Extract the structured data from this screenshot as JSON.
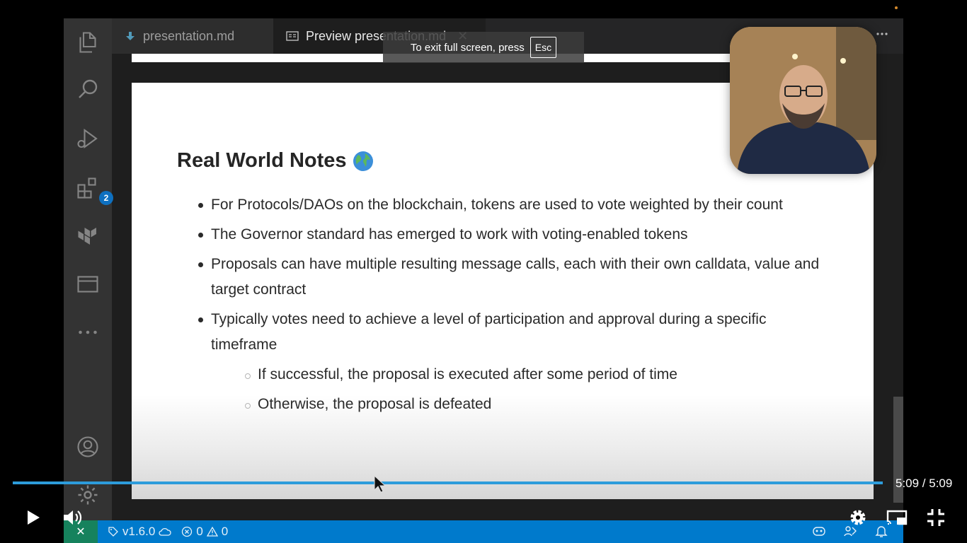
{
  "editor": {
    "tabs": [
      {
        "label": "presentation.md",
        "active": false
      },
      {
        "label": "Preview presentation.md",
        "active": true
      }
    ],
    "activity_bar": {
      "items": [
        "explorer",
        "search",
        "run-debug",
        "extensions",
        "terraform",
        "panel",
        "more"
      ],
      "extensions_badge": "2"
    },
    "status_bar": {
      "version": "v1.6.0",
      "errors": "0",
      "warnings": "0"
    }
  },
  "slide": {
    "title": "Real World Notes",
    "bullets": [
      "For Protocols/DAOs on the blockchain, tokens are used to vote weighted by their count",
      "The Governor standard has emerged to work with voting-enabled tokens",
      "Proposals can have multiple resulting message calls, each with their own calldata, value and target contract",
      "Typically votes need to achieve a level of participation and approval during a specific timeframe"
    ],
    "sub_bullets": [
      "If successful, the proposal is executed after some period of time",
      "Otherwise, the proposal is defeated"
    ]
  },
  "overlay": {
    "fullscreen_notice": "To exit full screen, press",
    "esc_key": "Esc"
  },
  "player": {
    "time": "5:09 / 5:09",
    "progress": 1.0,
    "accent_color": "#2d9cdb"
  }
}
